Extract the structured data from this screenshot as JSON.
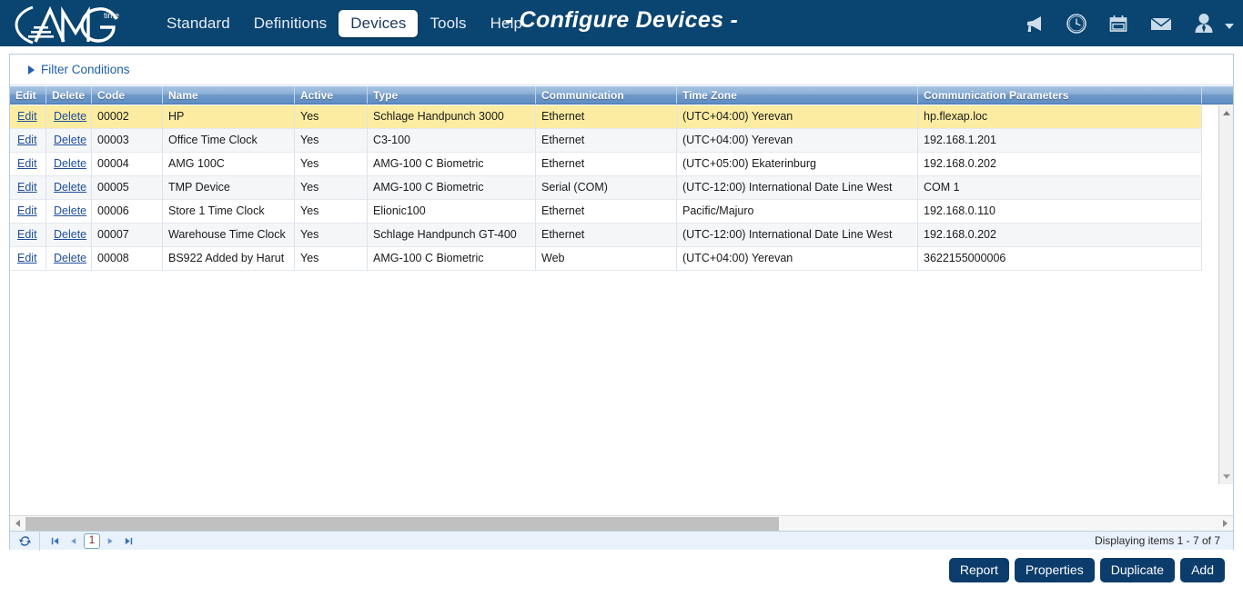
{
  "topbar": {
    "logo_text": "AMG",
    "logo_sub": "time",
    "title": "- Configure Devices -",
    "nav": [
      {
        "label": "Standard",
        "selected": false
      },
      {
        "label": "Definitions",
        "selected": false
      },
      {
        "label": "Devices",
        "selected": true
      },
      {
        "label": "Tools",
        "selected": false
      },
      {
        "label": "Help",
        "selected": false
      }
    ],
    "icons": [
      {
        "name": "megaphone-icon"
      },
      {
        "name": "clock-icon"
      },
      {
        "name": "calendar-icon"
      },
      {
        "name": "envelope-icon"
      },
      {
        "name": "user-icon"
      }
    ],
    "bg_color": "#0a4470"
  },
  "filter": {
    "label": "Filter Conditions",
    "expanded": false,
    "arrow_icon": "triangle-right-icon"
  },
  "grid": {
    "columns": [
      {
        "key": "edit",
        "label": "Edit"
      },
      {
        "key": "delete",
        "label": "Delete"
      },
      {
        "key": "code",
        "label": "Code"
      },
      {
        "key": "name",
        "label": "Name"
      },
      {
        "key": "active",
        "label": "Active"
      },
      {
        "key": "type",
        "label": "Type"
      },
      {
        "key": "comm",
        "label": "Communication"
      },
      {
        "key": "tz",
        "label": "Time Zone"
      },
      {
        "key": "param",
        "label": "Communication Parameters"
      }
    ],
    "edit_label": "Edit",
    "delete_label": "Delete",
    "selected_row_color": "#fbeca1",
    "rows": [
      {
        "code": "00002",
        "name": "HP",
        "active": "Yes",
        "type": "Schlage Handpunch 3000",
        "comm": "Ethernet",
        "tz": "(UTC+04:00) Yerevan",
        "param": "hp.flexap.loc",
        "selected": true
      },
      {
        "code": "00003",
        "name": "Office Time Clock",
        "active": "Yes",
        "type": "C3-100",
        "comm": "Ethernet",
        "tz": "(UTC+04:00) Yerevan",
        "param": "192.168.1.201",
        "selected": false
      },
      {
        "code": "00004",
        "name": "AMG 100C",
        "active": "Yes",
        "type": "AMG-100 C Biometric",
        "comm": "Ethernet",
        "tz": "(UTC+05:00) Ekaterinburg",
        "param": "192.168.0.202",
        "selected": false
      },
      {
        "code": "00005",
        "name": "TMP Device",
        "active": "Yes",
        "type": "AMG-100 C Biometric",
        "comm": "Serial (COM)",
        "tz": "(UTC-12:00) International Date Line West",
        "param": "COM 1",
        "selected": false
      },
      {
        "code": "00006",
        "name": "Store 1 Time Clock",
        "active": "Yes",
        "type": "Elionic100",
        "comm": "Ethernet",
        "tz": "Pacific/Majuro",
        "param": "192.168.0.110",
        "selected": false
      },
      {
        "code": "00007",
        "name": "Warehouse Time Clock",
        "active": "Yes",
        "type": "Schlage Handpunch GT-400",
        "comm": "Ethernet",
        "tz": "(UTC-12:00) International Date Line West",
        "param": "192.168.0.202",
        "selected": false
      },
      {
        "code": "00008",
        "name": "BS922 Added by Harut",
        "active": "Yes",
        "type": "AMG-100 C Biometric",
        "comm": "Web",
        "tz": "(UTC+04:00) Yerevan",
        "param": "3622155000006",
        "selected": false
      }
    ]
  },
  "pager": {
    "refresh_icon": "refresh-icon",
    "first_icon": "first-page-icon",
    "prev_icon": "prev-page-icon",
    "next_icon": "next-page-icon",
    "last_icon": "last-page-icon",
    "current_page": "1",
    "status": "Displaying items 1 - 7 of 7"
  },
  "actions": [
    {
      "label": "Report"
    },
    {
      "label": "Properties"
    },
    {
      "label": "Duplicate"
    },
    {
      "label": "Add"
    }
  ]
}
